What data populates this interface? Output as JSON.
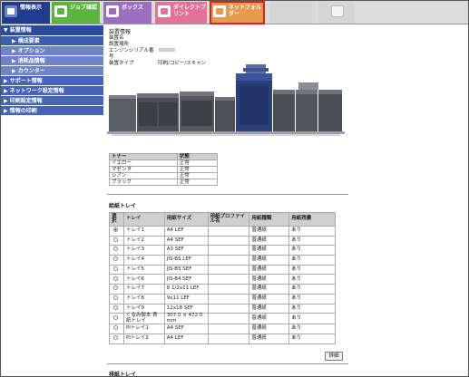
{
  "tabs": [
    {
      "label": "情報表示"
    },
    {
      "label": "ジョブ確認"
    },
    {
      "label": "ボックス"
    },
    {
      "label": "ダイレクトプリント"
    },
    {
      "label": "ネットフォルダー"
    }
  ],
  "sidebar": {
    "section": "▼ 装置情報",
    "subitems": [
      "▶ 構成要素",
      "▶ オプション",
      "▶ 消耗品情報",
      "▶ カウンター"
    ],
    "items": [
      "▶ サポート情報",
      "▶ ネットワーク設定情報",
      "▶ 印刷設定情報",
      "▶ 情報の印刷"
    ]
  },
  "device": {
    "title": "装置情報",
    "rows": [
      {
        "label": "装置名",
        "value": ""
      },
      {
        "label": "設置場所",
        "value": ""
      },
      {
        "label": "エンジンシリアル番号",
        "value": ""
      },
      {
        "label": "装置タイプ",
        "value": "印刷/コピー/スキャン"
      }
    ]
  },
  "toner": {
    "headers": [
      "トナー",
      "状態"
    ],
    "rows": [
      [
        "イエロー",
        "正常"
      ],
      [
        "マゼンタ",
        "正常"
      ],
      [
        "シアン",
        "正常"
      ],
      [
        "ブラック",
        "正常"
      ]
    ]
  },
  "paper_tray": {
    "title": "給紙トレイ",
    "headers": [
      "選択",
      "トレイ",
      "用紙サイズ",
      "用紙プロファイル名",
      "用紙種類",
      "用紙残量"
    ],
    "selected_index": 0,
    "rows": [
      [
        "トレイ1",
        "A4 LEF",
        "",
        "普通紙",
        "あり"
      ],
      [
        "トレイ2",
        "A4 SEF",
        "",
        "普通紙",
        "あり"
      ],
      [
        "トレイ3",
        "A3 SEF",
        "",
        "普通紙",
        "あり"
      ],
      [
        "トレイ4",
        "JIS-B5 LEF",
        "",
        "普通紙",
        "あり"
      ],
      [
        "トレイ5",
        "JIS-B5 SEF",
        "",
        "普通紙",
        "あり"
      ],
      [
        "トレイ6",
        "JIS-B4 SEF",
        "",
        "普通紙",
        "あり"
      ],
      [
        "トレイ7",
        "8 1/2x11 LEF",
        "",
        "普通紙",
        "あり"
      ],
      [
        "トレイ8",
        "9x11 LEF",
        "",
        "普通紙",
        "あり"
      ],
      [
        "トレイ9",
        "12x18 SEF",
        "",
        "普通紙",
        "あり"
      ],
      [
        "くるみ製本 表紙トレイ",
        "307.0 × 472.0 mm",
        "",
        "普通紙",
        "あり"
      ],
      [
        "PIトレイ1",
        "A4 SEF",
        "",
        "普通紙",
        "あり"
      ],
      [
        "PIトレイ2",
        "A4 LEF",
        "",
        "普通紙",
        "あり"
      ]
    ],
    "detail_button": "詳細"
  },
  "output_tray": {
    "title": "排紙トレイ"
  }
}
